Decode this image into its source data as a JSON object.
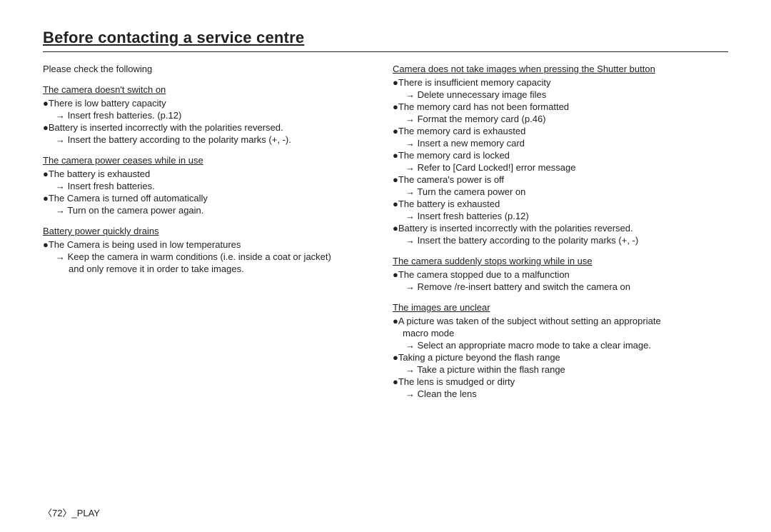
{
  "page": {
    "title": "Before contacting a service centre",
    "footer": "〈72〉_PLAY"
  },
  "left": {
    "intro": "Please check the following",
    "sections": [
      {
        "id": "section-camera-switch",
        "title": "The camera doesn't switch on",
        "items": [
          {
            "bullet": "●There is low battery capacity",
            "arrow": "→  Insert fresh batteries. (p.12)"
          },
          {
            "bullet": "●Battery is inserted incorrectly with the polarities reversed.",
            "arrow": "→  Insert the battery according to the polarity marks (+, -)."
          }
        ]
      },
      {
        "id": "section-camera-power",
        "title": "The camera power ceases while in use",
        "items": [
          {
            "bullet": "●The battery is exhausted",
            "arrow": "→  Insert fresh batteries."
          },
          {
            "bullet": "●The Camera is turned off automatically",
            "arrow": "→  Turn on the camera power again."
          }
        ]
      },
      {
        "id": "section-battery-drains",
        "title": "Battery power quickly drains",
        "items": [
          {
            "bullet": "●The Camera is being used in low temperatures",
            "arrow": "→  Keep the camera in warm conditions (i.e. inside a coat or jacket)",
            "arrow2": "and only remove it in order to take images."
          }
        ]
      }
    ]
  },
  "right": {
    "sections": [
      {
        "id": "section-shutter",
        "title": "Camera does not take images when pressing the Shutter button",
        "items": [
          {
            "bullet": "●There is insufficient memory capacity",
            "arrow": "→  Delete unnecessary image files"
          },
          {
            "bullet": "●The memory card has not been formatted",
            "arrow": "→  Format the memory card (p.46)"
          },
          {
            "bullet": "●The memory card is exhausted",
            "arrow": "→  Insert a new memory card"
          },
          {
            "bullet": "●The memory card is locked",
            "arrow": "→  Refer to [Card Locked!] error message"
          },
          {
            "bullet": "●The camera's power is off",
            "arrow": "→  Turn the camera power on"
          },
          {
            "bullet": "●The battery is exhausted",
            "arrow": "→  Insert fresh batteries (p.12)"
          },
          {
            "bullet": "●Battery is inserted incorrectly with the polarities reversed.",
            "arrow": "→  Insert the battery according to the polarity marks (+, -)"
          }
        ]
      },
      {
        "id": "section-suddenly-stops",
        "title": "The camera suddenly stops working while in use",
        "items": [
          {
            "bullet": "●The camera stopped due to a malfunction",
            "arrow": "→  Remove /re-insert battery and switch the camera on"
          }
        ]
      },
      {
        "id": "section-unclear",
        "title": "The images are unclear",
        "items": [
          {
            "bullet": "●A picture was taken of the subject without setting an appropriate",
            "bullet2": "macro mode",
            "arrow": "→  Select an appropriate macro mode to take a clear image."
          },
          {
            "bullet": "●Taking a picture beyond the flash range",
            "arrow": "→  Take a picture within the flash range"
          },
          {
            "bullet": "●The lens is smudged or dirty",
            "arrow": "→  Clean the lens"
          }
        ]
      }
    ]
  }
}
